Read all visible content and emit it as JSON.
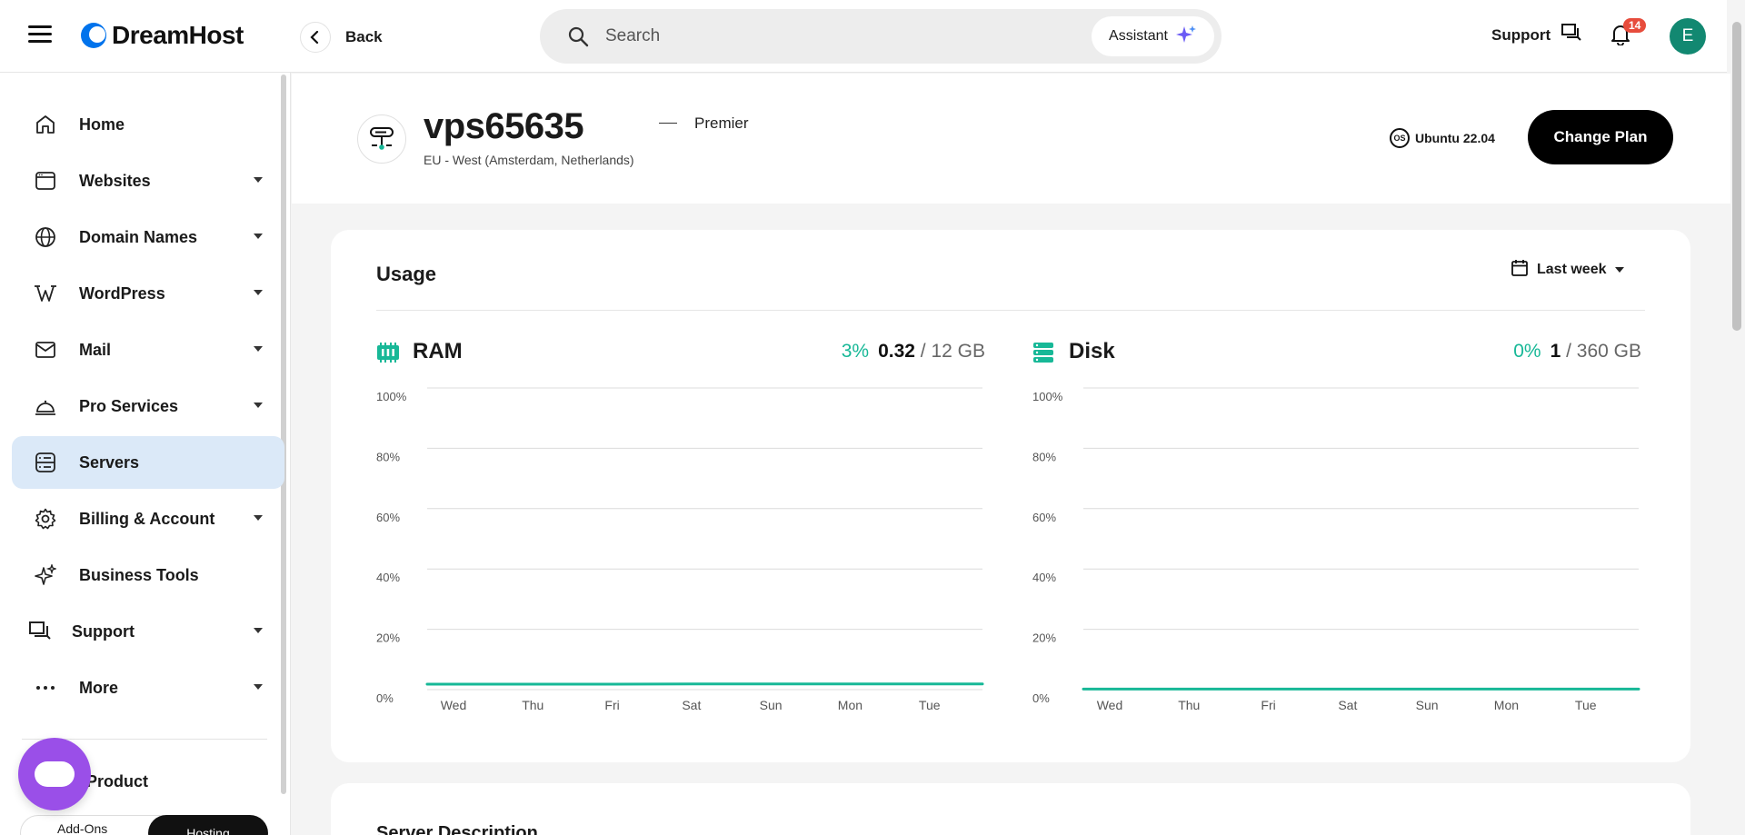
{
  "brand": {
    "name": "DreamHost",
    "accent": "#0073ec"
  },
  "topbar": {
    "back_label": "Back",
    "search_placeholder": "Search",
    "assistant_label": "Assistant",
    "support_label": "Support",
    "notification_count": "14",
    "avatar_initial": "E"
  },
  "sidebar": {
    "items": [
      {
        "label": "Home",
        "icon": "home-icon",
        "has_caret": false
      },
      {
        "label": "Websites",
        "icon": "browser-window-icon",
        "has_caret": true
      },
      {
        "label": "Domain Names",
        "icon": "globe-icon",
        "has_caret": true
      },
      {
        "label": "WordPress",
        "icon": "wordpress-icon",
        "has_caret": true
      },
      {
        "label": "Mail",
        "icon": "envelope-icon",
        "has_caret": true
      },
      {
        "label": "Pro Services",
        "icon": "service-bell-icon",
        "has_caret": true
      },
      {
        "label": "Servers",
        "icon": "server-icon",
        "has_caret": false,
        "active": true
      },
      {
        "label": "Billing & Account",
        "icon": "gear-icon",
        "has_caret": true
      },
      {
        "label": "Business Tools",
        "icon": "sparkle-icon",
        "has_caret": false
      },
      {
        "label": "Support",
        "icon": "chat-icon",
        "has_caret": true
      },
      {
        "label": "More",
        "icon": "more-dots-icon",
        "has_caret": true
      }
    ],
    "product_label": "Product",
    "toggle": {
      "left": "Add-Ons",
      "right": "Hosting"
    }
  },
  "server": {
    "name": "vps65635",
    "location": "EU - West (Amsterdam, Netherlands)",
    "plan": "Premier",
    "os_icon_text": "OS",
    "os": "Ubuntu 22.04",
    "change_plan_label": "Change Plan"
  },
  "usage": {
    "title": "Usage",
    "period": "Last week"
  },
  "chart_data": [
    {
      "type": "line",
      "title": "RAM",
      "percent": "3%",
      "used": "0.32",
      "total": "/ 12 GB",
      "x": [
        "Wed",
        "Thu",
        "Fri",
        "Sat",
        "Sun",
        "Mon",
        "Tue"
      ],
      "series": [
        {
          "values": [
            1.8,
            1.8,
            1.8,
            1.9,
            1.9,
            1.9,
            1.9
          ]
        }
      ],
      "y_ticks": [
        "100%",
        "80%",
        "60%",
        "40%",
        "20%",
        "0%"
      ],
      "ylim": [
        0,
        100
      ],
      "color": "#17b897",
      "grid": true
    },
    {
      "type": "line",
      "title": "Disk",
      "percent": "0%",
      "used": "1",
      "total": "/ 360 GB",
      "x": [
        "Wed",
        "Thu",
        "Fri",
        "Sat",
        "Sun",
        "Mon",
        "Tue"
      ],
      "series": [
        {
          "values": [
            0.2,
            0.2,
            0.2,
            0.2,
            0.2,
            0.2,
            0.2
          ]
        }
      ],
      "y_ticks": [
        "100%",
        "80%",
        "60%",
        "40%",
        "20%",
        "0%"
      ],
      "ylim": [
        0,
        100
      ],
      "color": "#17b897",
      "grid": true
    }
  ],
  "description": {
    "title": "Server Description"
  }
}
